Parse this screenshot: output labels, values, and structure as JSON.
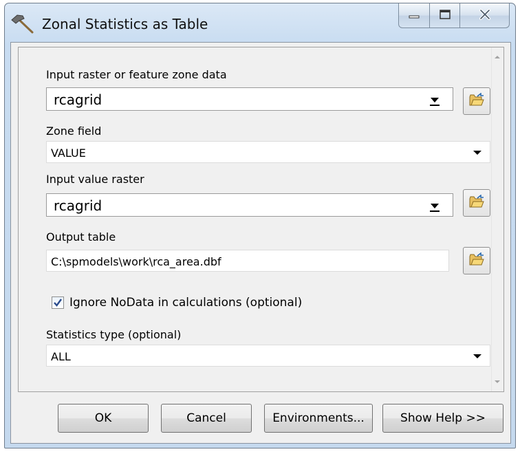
{
  "window": {
    "title": "Zonal Statistics as Table"
  },
  "icons": {
    "title": "hammer-icon",
    "minimize": "minimize-icon",
    "maximize": "maximize-icon",
    "close": "close-icon",
    "browse": "folder-open-icon",
    "dropdown": "chevron-down-icon"
  },
  "form": {
    "input_zone": {
      "label": "Input raster or feature zone data",
      "value": "rcagrid"
    },
    "zone_field": {
      "label": "Zone field",
      "value": "VALUE"
    },
    "input_value": {
      "label": "Input value raster",
      "value": "rcagrid"
    },
    "output_table": {
      "label": "Output table",
      "value": "C:\\spmodels\\work\\rca_area.dbf"
    },
    "ignore_nodata": {
      "label": "Ignore NoData in calculations (optional)",
      "checked": true
    },
    "statistics_type": {
      "label": "Statistics type (optional)",
      "value": "ALL"
    }
  },
  "buttons": {
    "ok": "OK",
    "cancel": "Cancel",
    "environments": "Environments...",
    "show_help": "Show Help >>"
  }
}
